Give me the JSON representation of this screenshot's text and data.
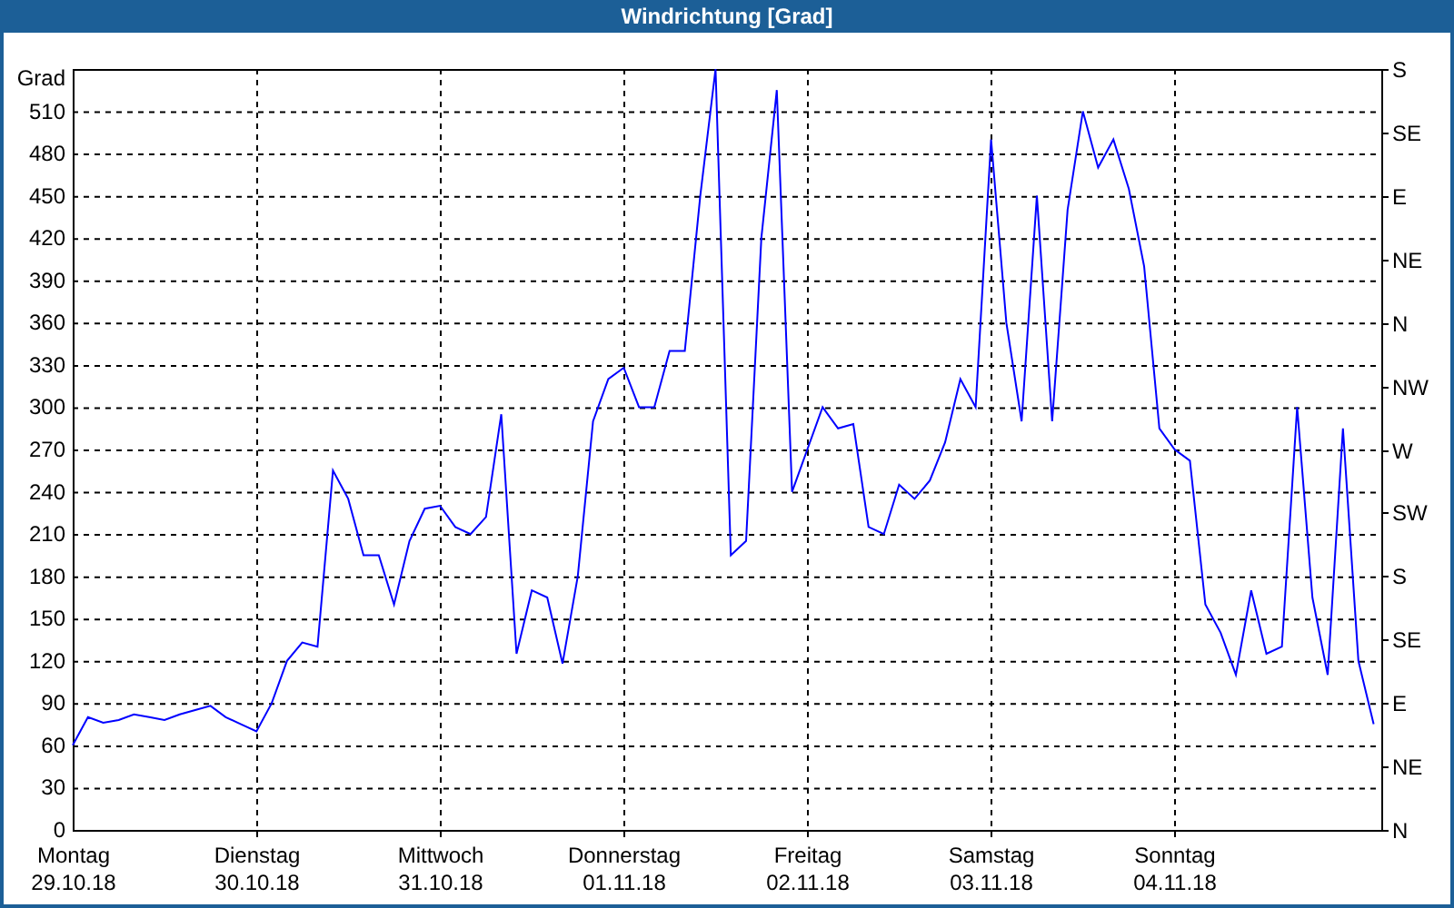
{
  "window": {
    "title": "Windrichtung [Grad]"
  },
  "chart": {
    "y_unit_label": "Grad",
    "date_labels": [
      "29.10.18",
      "30.10.18",
      "31.10.18",
      "01.11.18",
      "02.11.18",
      "03.11.18",
      "04.11.18"
    ],
    "right_ticks": [
      "S",
      "SE",
      "E",
      "NE",
      "N",
      "NW",
      "W",
      "SW",
      "S",
      "SE",
      "E",
      "NE",
      "N"
    ],
    "chart_data": {
      "type": "line",
      "grid": true,
      "ylim": [
        0,
        540
      ],
      "yticks": [
        0,
        30,
        60,
        90,
        120,
        150,
        180,
        210,
        240,
        270,
        300,
        330,
        360,
        390,
        420,
        450,
        480,
        510
      ],
      "categories": [
        "Montag",
        null,
        null,
        null,
        null,
        null,
        null,
        null,
        null,
        null,
        null,
        null,
        "Dienstag",
        null,
        null,
        null,
        null,
        null,
        null,
        null,
        null,
        null,
        null,
        null,
        "Mittwoch",
        null,
        null,
        null,
        null,
        null,
        null,
        null,
        null,
        null,
        null,
        null,
        "Donnerstag",
        null,
        null,
        null,
        null,
        null,
        null,
        null,
        null,
        null,
        null,
        null,
        "Freitag",
        null,
        null,
        null,
        null,
        null,
        null,
        null,
        null,
        null,
        null,
        null,
        "Samstag",
        null,
        null,
        null,
        null,
        null,
        null,
        null,
        null,
        null,
        null,
        null,
        "Sonntag",
        null,
        null,
        null,
        null,
        null,
        null,
        null,
        null,
        null,
        null,
        null,
        null,
        null
      ],
      "series": [
        {
          "color": "#0000ff",
          "values": [
            60,
            80,
            76,
            78,
            82,
            80,
            78,
            82,
            85,
            88,
            80,
            75,
            70,
            90,
            120,
            133,
            130,
            255,
            235,
            195,
            195,
            160,
            205,
            228,
            230,
            215,
            210,
            222,
            295,
            125,
            170,
            165,
            118,
            180,
            290,
            320,
            328,
            300,
            300,
            340,
            340,
            450,
            540,
            195,
            205,
            420,
            525,
            240,
            270,
            300,
            285,
            288,
            215,
            210,
            245,
            235,
            248,
            275,
            320,
            300,
            490,
            360,
            290,
            450,
            290,
            440,
            510,
            470,
            490,
            455,
            400,
            285,
            270,
            262,
            160,
            140,
            110,
            170,
            125,
            130,
            300,
            165,
            110,
            285,
            120,
            75
          ]
        }
      ]
    }
  }
}
